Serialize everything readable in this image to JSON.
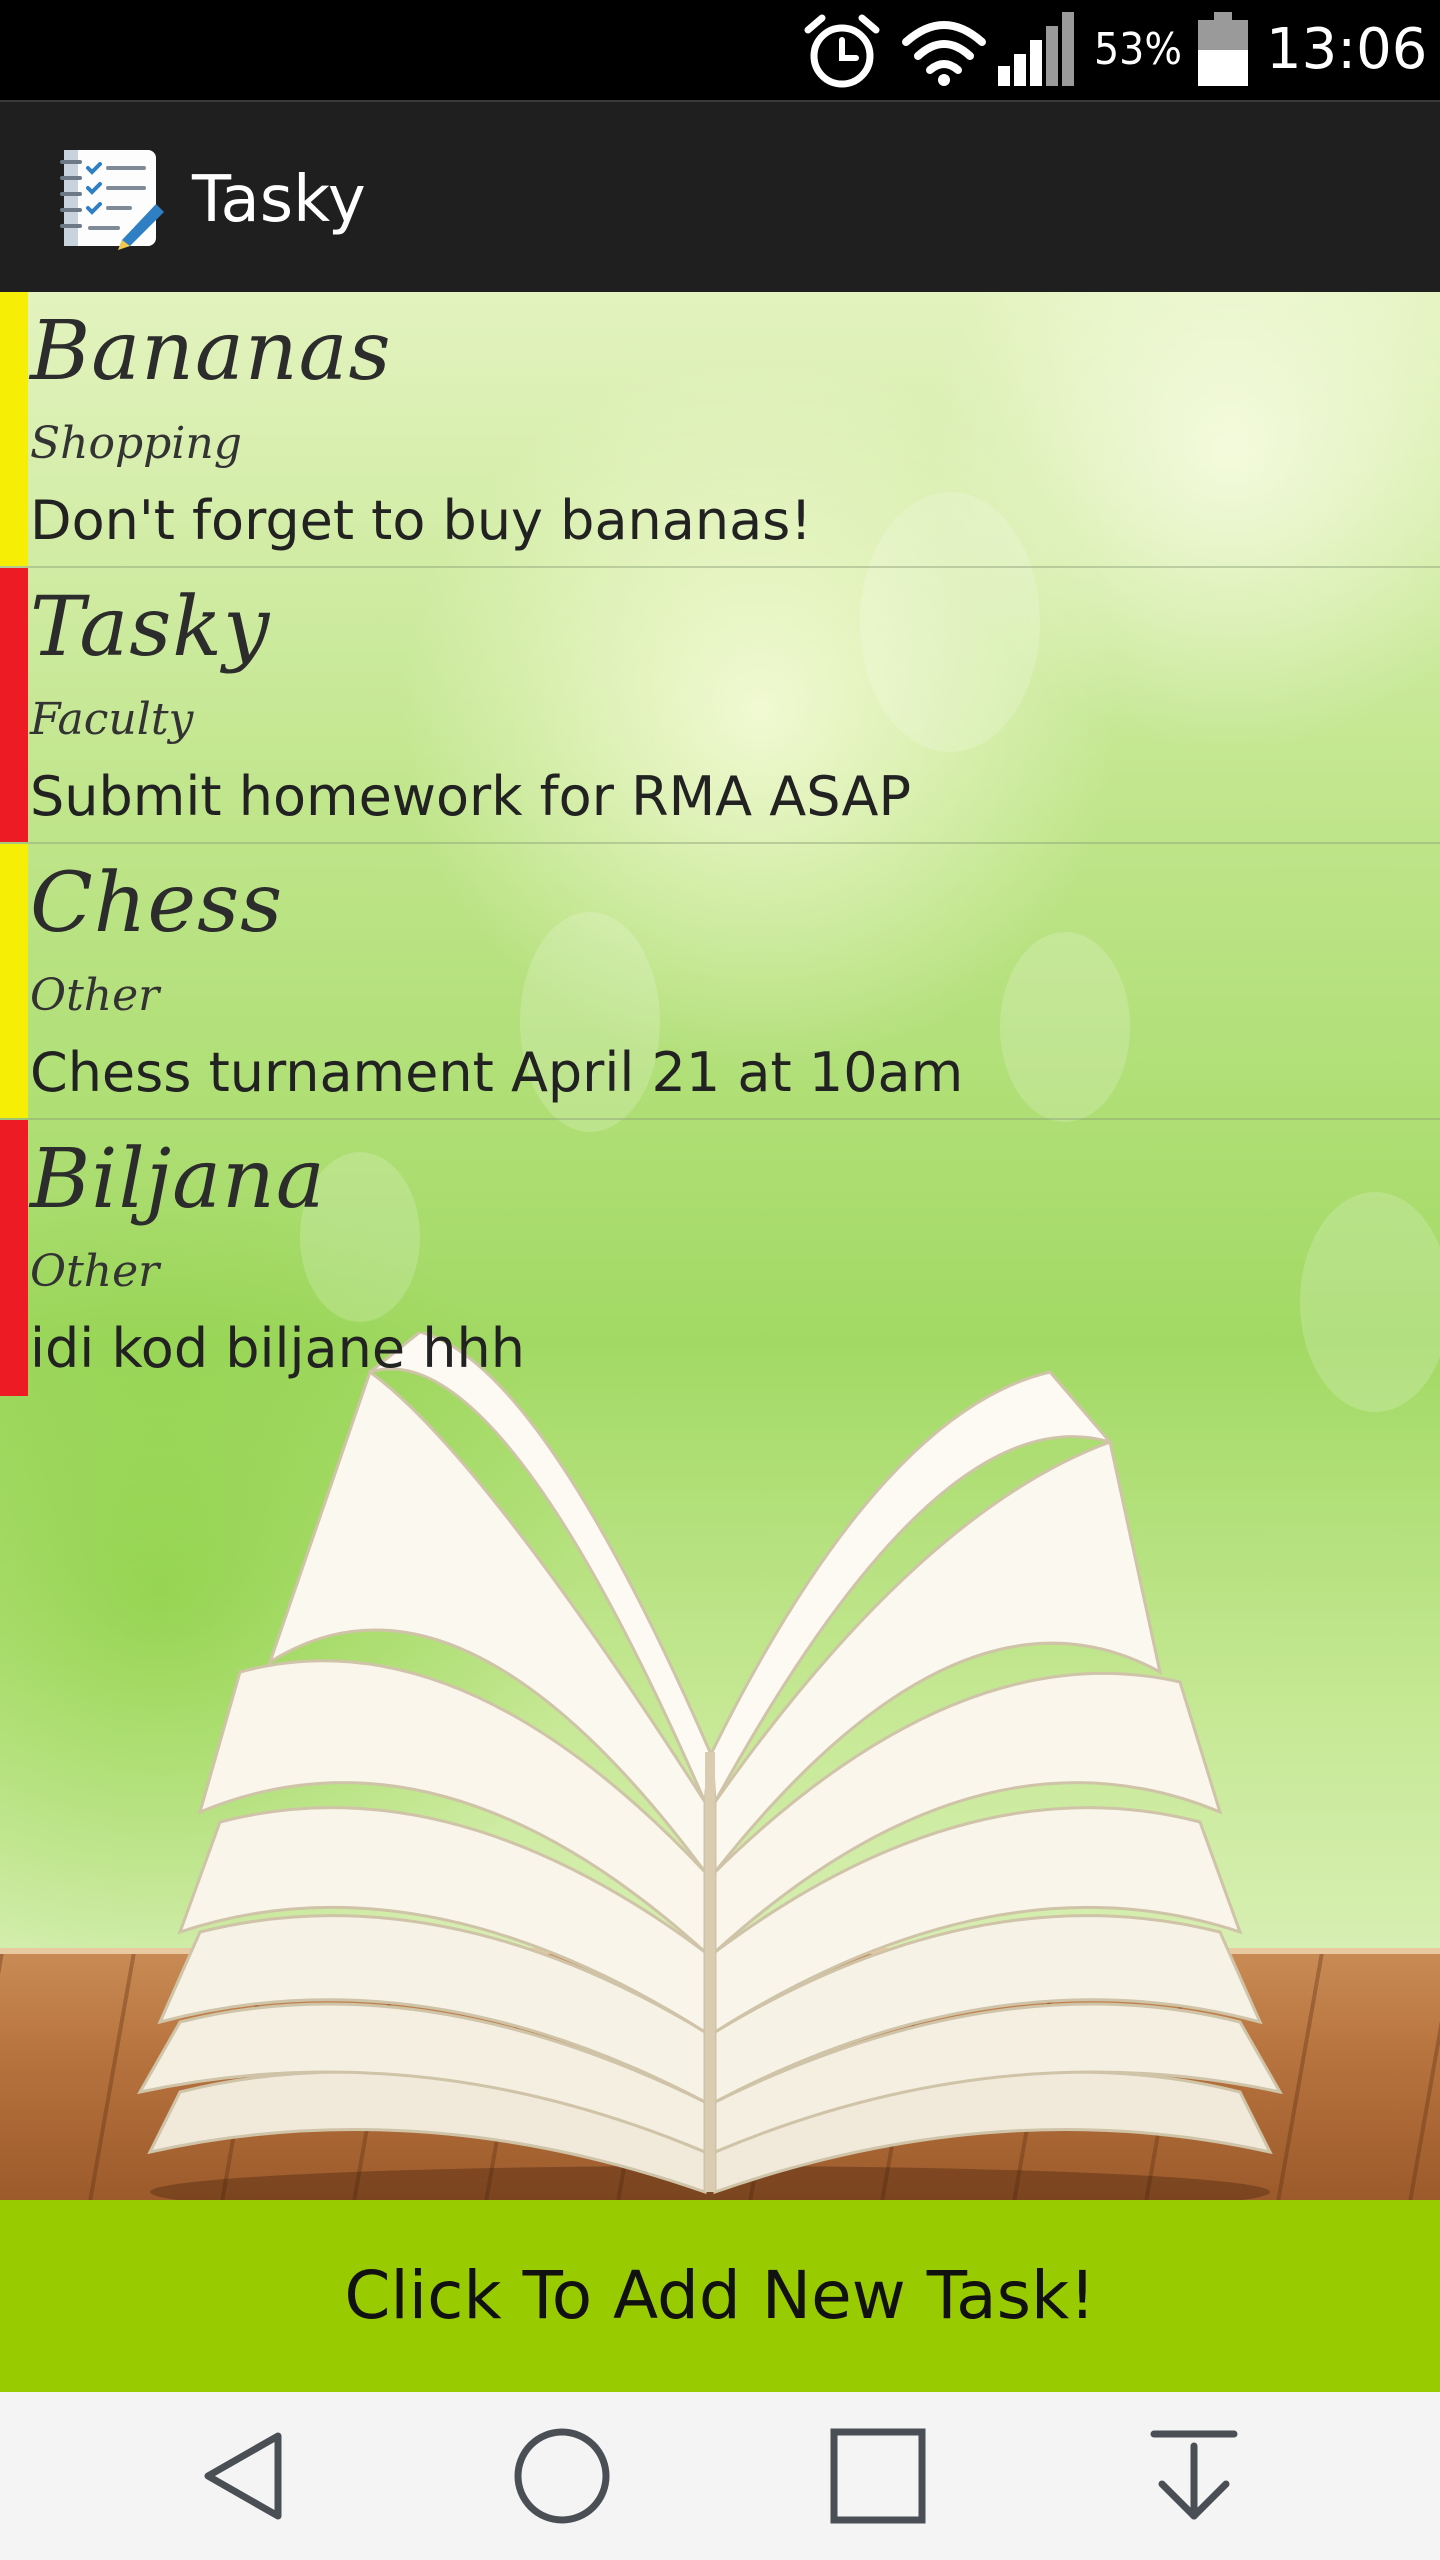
{
  "status_bar": {
    "battery_percent": "53%",
    "time": "13:06",
    "icons": [
      "alarm-icon",
      "wifi-icon",
      "signal-icon",
      "battery-icon"
    ]
  },
  "action_bar": {
    "title": "Tasky",
    "icon": "checklist-icon"
  },
  "tasks": [
    {
      "title": "Bananas",
      "category": "Shopping",
      "description": "Don't forget to buy bananas!",
      "priority_color": "#f7ee06"
    },
    {
      "title": "Tasky",
      "category": "Faculty",
      "description": "Submit homework for RMA ASAP",
      "priority_color": "#ed1c24"
    },
    {
      "title": "Chess",
      "category": "Other",
      "description": "Chess turnament April 21 at 10am",
      "priority_color": "#f7ee06"
    },
    {
      "title": "Biljana",
      "category": "Other",
      "description": "idi kod biljane hhh",
      "priority_color": "#ed1c24"
    }
  ],
  "add_button": {
    "label": "Click To Add New Task!",
    "color": "#99cc00"
  },
  "nav_bar": {
    "buttons": [
      "back-icon",
      "home-icon",
      "recents-icon",
      "notifications-pull-icon"
    ]
  }
}
